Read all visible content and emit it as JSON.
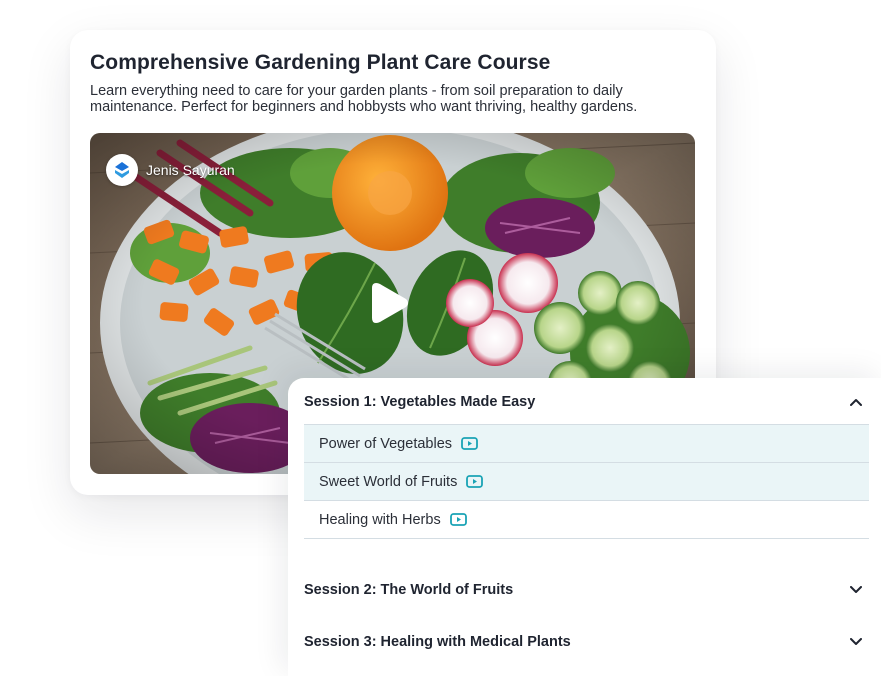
{
  "course": {
    "title": "Comprehensive Gardening Plant Care Course",
    "description": "Learn everything need to care for your garden plants - from soil preparation to daily maintenance. Perfect for beginners and hobbysts who want thriving, healthy gardens."
  },
  "video": {
    "channel_name": "Jenis Sayuran"
  },
  "sessions": [
    {
      "title": "Session 1: Vegetables Made Easy",
      "expanded": true,
      "lessons": [
        {
          "label": "Power of Vegetables",
          "active": true
        },
        {
          "label": "Sweet World of Fruits",
          "active": true
        },
        {
          "label": "Healing with Herbs",
          "active": false
        }
      ]
    },
    {
      "title": "Session 2: The World of Fruits",
      "expanded": false
    },
    {
      "title": "Session 3: Healing with Medical Plants",
      "expanded": false
    }
  ],
  "colors": {
    "accent": "#1aa3b5",
    "active_row": "#eaf5f7",
    "divider": "#d4dde3"
  },
  "icons": {
    "play": "play-icon",
    "lesson": "video-lesson-icon",
    "collapse": "chevron-up-icon",
    "expand": "chevron-down-icon"
  }
}
